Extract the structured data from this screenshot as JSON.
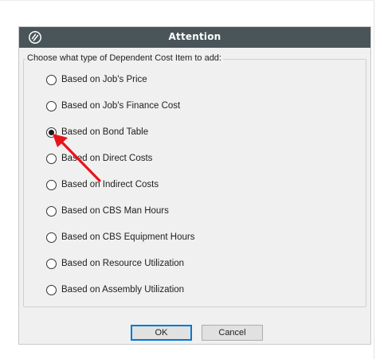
{
  "dialog": {
    "title": "Attention",
    "logo_icon": "app-logo-icon",
    "group_label": "Choose what type of Dependent Cost Item to add:",
    "options": [
      {
        "label": "Based on Job's Price",
        "checked": false
      },
      {
        "label": "Based on Job's Finance Cost",
        "checked": false
      },
      {
        "label": "Based on Bond Table",
        "checked": true
      },
      {
        "label": "Based on Direct Costs",
        "checked": false
      },
      {
        "label": "Based on Indirect Costs",
        "checked": false
      },
      {
        "label": "Based on CBS Man Hours",
        "checked": false
      },
      {
        "label": "Based on CBS Equipment Hours",
        "checked": false
      },
      {
        "label": "Based on Resource Utilization",
        "checked": false
      },
      {
        "label": "Based on Assembly Utilization",
        "checked": false
      }
    ],
    "ok_label": "OK",
    "cancel_label": "Cancel"
  },
  "annotation": {
    "arrow_color": "#e8141b",
    "points_to": "Based on Bond Table"
  },
  "colors": {
    "titlebar": "#4a5559",
    "dialog_bg": "#f0f0f0",
    "ok_border": "#0078d7"
  }
}
